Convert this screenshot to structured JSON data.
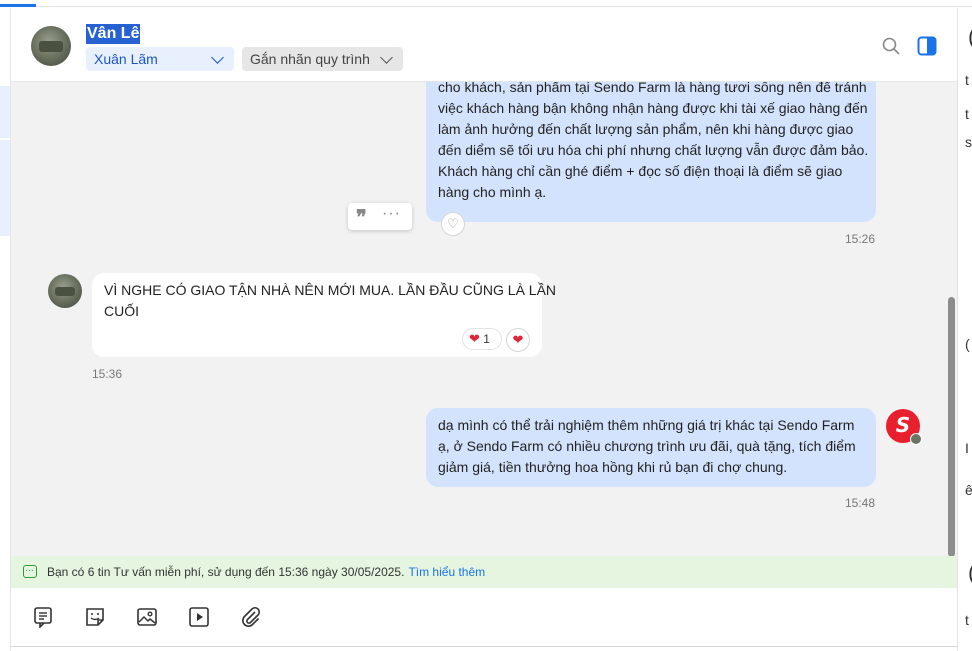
{
  "header": {
    "contact_name": "Vân Lê",
    "assignee": "Xuân Lãm",
    "label_select": "Gắn nhãn quy trình"
  },
  "messages": [
    {
      "direction": "outgoing",
      "lines": [
        "cho khách, sản phẩm tại Sendo Farm là hàng tươi sống nên để tránh",
        "việc khách hàng bận không nhận hàng được khi tài xế giao hàng đến",
        "làm ảnh hưởng đến chất lượng sản phẩm, nên khi hàng được giao",
        "đến diểm sẽ tối ưu hóa chi phí nhưng chất lượng vẫn được đảm bảo.",
        "Khách hàng chỉ cần ghé điểm + đọc số điện thoại là điểm sẽ giao",
        "hàng cho mình ạ."
      ],
      "time": "15:26"
    },
    {
      "direction": "incoming",
      "lines": [
        "VÌ NGHE CÓ GIAO TẬN NHÀ NÊN MỚI MUA. LẦN ĐẦU CŨNG LÀ LẦN",
        "CUỐI"
      ],
      "reaction_count": "1",
      "time": "15:36"
    },
    {
      "direction": "outgoing",
      "lines": [
        "dạ mình có thể trải nghiệm thêm những giá trị khác tại Sendo Farm",
        "ạ, ở Sendo Farm có nhiều chương trình ưu đãi, quà tặng, tích điểm",
        "giảm giá, tiền thưởng hoa hồng khi rủ bạn đi chợ chung."
      ],
      "time": "15:48"
    }
  ],
  "hover_actions": {
    "quote": "❞",
    "more": "···"
  },
  "reaction_icons": {
    "heart": "❤",
    "add_reaction": "♡"
  },
  "notice": {
    "text": "Bạn có 6 tin Tư vấn miễn phí, sử dụng đến 15:36 ngày 30/05/2025.",
    "link": "Tìm hiểu thêm"
  },
  "sendo_logo_text": "S",
  "right_panel_fragments": [
    "(",
    "t",
    "t",
    "s",
    "(",
    "I",
    "ê",
    "(",
    "t"
  ],
  "icons": {
    "header": [
      "search-icon",
      "panel-toggle-icon"
    ],
    "composer": [
      "quick-reply-icon",
      "sticker-icon",
      "image-icon",
      "video-icon",
      "attachment-icon"
    ]
  },
  "colors": {
    "outgoing_bubble": "#d4e3fd",
    "incoming_bubble": "#ffffff",
    "chat_background": "#f2f2f2",
    "notice_background": "#e5f5e0",
    "accent": "#1a73e8",
    "brand_red": "#e81f2d"
  }
}
